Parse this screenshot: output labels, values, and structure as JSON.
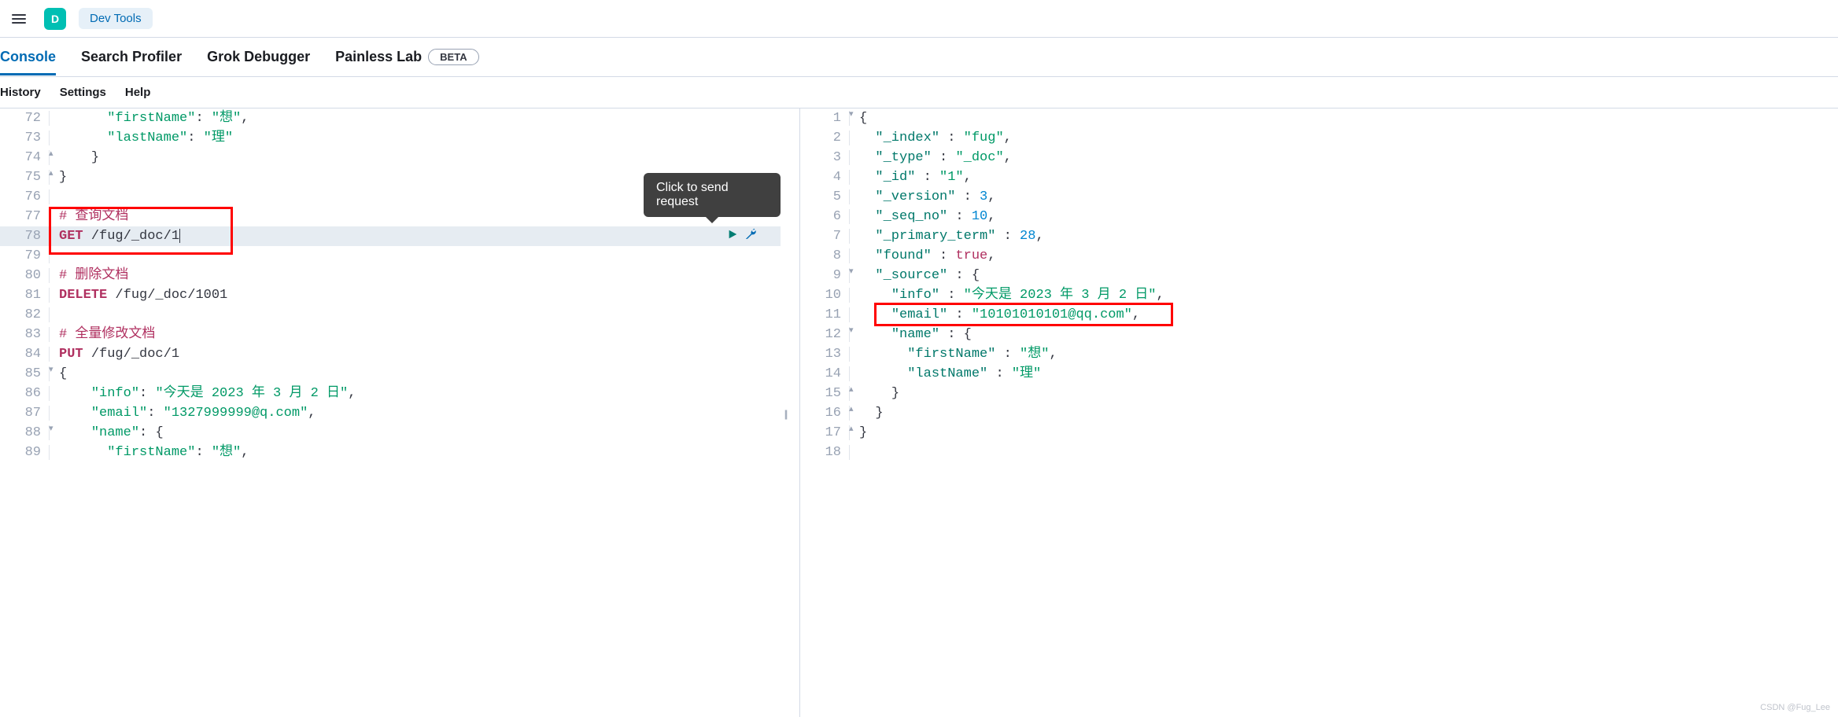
{
  "header": {
    "appInitial": "D",
    "appName": "Dev Tools"
  },
  "tabs": {
    "items": [
      "Console",
      "Search Profiler",
      "Grok Debugger",
      "Painless Lab"
    ],
    "activeIndex": 0,
    "betaBadge": "BETA"
  },
  "subnav": {
    "items": [
      "History",
      "Settings",
      "Help"
    ]
  },
  "tooltip": "Click to send request",
  "leftEditor": {
    "startLine": 72,
    "lines": [
      {
        "n": 72,
        "indent": "      ",
        "tokens": [
          {
            "t": "\"firstName\"",
            "c": "k-key"
          },
          {
            "t": ": ",
            "c": "k-punc"
          },
          {
            "t": "\"想\"",
            "c": "k-str"
          },
          {
            "t": ",",
            "c": "k-punc"
          }
        ]
      },
      {
        "n": 73,
        "indent": "      ",
        "tokens": [
          {
            "t": "\"lastName\"",
            "c": "k-key"
          },
          {
            "t": ": ",
            "c": "k-punc"
          },
          {
            "t": "\"理\"",
            "c": "k-str"
          }
        ]
      },
      {
        "n": 74,
        "indent": "    ",
        "fold": "up",
        "tokens": [
          {
            "t": "}",
            "c": "k-punc"
          }
        ]
      },
      {
        "n": 75,
        "indent": "",
        "fold": "up",
        "tokens": [
          {
            "t": "}",
            "c": "k-punc"
          }
        ]
      },
      {
        "n": 76,
        "indent": "",
        "tokens": []
      },
      {
        "n": 77,
        "indent": "",
        "tokens": [
          {
            "t": "# 查询文档",
            "c": "k-comment"
          }
        ]
      },
      {
        "n": 78,
        "indent": "",
        "hl": true,
        "actions": true,
        "tokens": [
          {
            "t": "GET",
            "c": "k-method"
          },
          {
            "t": " ",
            "c": ""
          },
          {
            "t": "/fug/_doc/1",
            "c": "k-path"
          }
        ],
        "cursor": true
      },
      {
        "n": 79,
        "indent": "",
        "tokens": []
      },
      {
        "n": 80,
        "indent": "",
        "tokens": [
          {
            "t": "# 删除文档",
            "c": "k-comment"
          }
        ]
      },
      {
        "n": 81,
        "indent": "",
        "tokens": [
          {
            "t": "DELETE",
            "c": "k-method"
          },
          {
            "t": " ",
            "c": ""
          },
          {
            "t": "/fug/_doc/1001",
            "c": "k-path"
          }
        ]
      },
      {
        "n": 82,
        "indent": "",
        "tokens": []
      },
      {
        "n": 83,
        "indent": "",
        "tokens": [
          {
            "t": "# 全量修改文档",
            "c": "k-comment"
          }
        ]
      },
      {
        "n": 84,
        "indent": "",
        "tokens": [
          {
            "t": "PUT",
            "c": "k-method"
          },
          {
            "t": " ",
            "c": ""
          },
          {
            "t": "/fug/_doc/1",
            "c": "k-path"
          }
        ]
      },
      {
        "n": 85,
        "indent": "",
        "fold": "down",
        "tokens": [
          {
            "t": "{",
            "c": "k-punc"
          }
        ]
      },
      {
        "n": 86,
        "indent": "    ",
        "tokens": [
          {
            "t": "\"info\"",
            "c": "k-key"
          },
          {
            "t": ": ",
            "c": "k-punc"
          },
          {
            "t": "\"今天是 2023 年 3 月 2 日\"",
            "c": "k-str"
          },
          {
            "t": ",",
            "c": "k-punc"
          }
        ]
      },
      {
        "n": 87,
        "indent": "    ",
        "tokens": [
          {
            "t": "\"email\"",
            "c": "k-key"
          },
          {
            "t": ": ",
            "c": "k-punc"
          },
          {
            "t": "\"1327999999@q.com\"",
            "c": "k-str"
          },
          {
            "t": ",",
            "c": "k-punc"
          }
        ]
      },
      {
        "n": 88,
        "indent": "    ",
        "fold": "down",
        "tokens": [
          {
            "t": "\"name\"",
            "c": "k-key"
          },
          {
            "t": ": ",
            "c": "k-punc"
          },
          {
            "t": "{",
            "c": "k-punc"
          }
        ]
      },
      {
        "n": 89,
        "indent": "      ",
        "tokens": [
          {
            "t": "\"firstName\"",
            "c": "k-key"
          },
          {
            "t": ": ",
            "c": "k-punc"
          },
          {
            "t": "\"想\"",
            "c": "k-str"
          },
          {
            "t": ",",
            "c": "k-punc"
          }
        ]
      }
    ]
  },
  "rightEditor": {
    "lines": [
      {
        "n": 1,
        "indent": "",
        "fold": "down",
        "tokens": [
          {
            "t": "{",
            "c": "k-punc"
          }
        ]
      },
      {
        "n": 2,
        "indent": "  ",
        "tokens": [
          {
            "t": "\"_index\"",
            "c": "k-label"
          },
          {
            "t": " : ",
            "c": "k-punc"
          },
          {
            "t": "\"fug\"",
            "c": "k-str"
          },
          {
            "t": ",",
            "c": "k-punc"
          }
        ]
      },
      {
        "n": 3,
        "indent": "  ",
        "tokens": [
          {
            "t": "\"_type\"",
            "c": "k-label"
          },
          {
            "t": " : ",
            "c": "k-punc"
          },
          {
            "t": "\"_doc\"",
            "c": "k-str"
          },
          {
            "t": ",",
            "c": "k-punc"
          }
        ]
      },
      {
        "n": 4,
        "indent": "  ",
        "tokens": [
          {
            "t": "\"_id\"",
            "c": "k-label"
          },
          {
            "t": " : ",
            "c": "k-punc"
          },
          {
            "t": "\"1\"",
            "c": "k-str"
          },
          {
            "t": ",",
            "c": "k-punc"
          }
        ]
      },
      {
        "n": 5,
        "indent": "  ",
        "tokens": [
          {
            "t": "\"_version\"",
            "c": "k-label"
          },
          {
            "t": " : ",
            "c": "k-punc"
          },
          {
            "t": "3",
            "c": "k-num"
          },
          {
            "t": ",",
            "c": "k-punc"
          }
        ]
      },
      {
        "n": 6,
        "indent": "  ",
        "tokens": [
          {
            "t": "\"_seq_no\"",
            "c": "k-label"
          },
          {
            "t": " : ",
            "c": "k-punc"
          },
          {
            "t": "10",
            "c": "k-num"
          },
          {
            "t": ",",
            "c": "k-punc"
          }
        ]
      },
      {
        "n": 7,
        "indent": "  ",
        "tokens": [
          {
            "t": "\"_primary_term\"",
            "c": "k-label"
          },
          {
            "t": " : ",
            "c": "k-punc"
          },
          {
            "t": "28",
            "c": "k-num"
          },
          {
            "t": ",",
            "c": "k-punc"
          }
        ]
      },
      {
        "n": 8,
        "indent": "  ",
        "tokens": [
          {
            "t": "\"found\"",
            "c": "k-label"
          },
          {
            "t": " : ",
            "c": "k-punc"
          },
          {
            "t": "true",
            "c": "k-bool"
          },
          {
            "t": ",",
            "c": "k-punc"
          }
        ]
      },
      {
        "n": 9,
        "indent": "  ",
        "fold": "down",
        "tokens": [
          {
            "t": "\"_source\"",
            "c": "k-label"
          },
          {
            "t": " : ",
            "c": "k-punc"
          },
          {
            "t": "{",
            "c": "k-punc"
          }
        ]
      },
      {
        "n": 10,
        "indent": "    ",
        "tokens": [
          {
            "t": "\"info\"",
            "c": "k-label"
          },
          {
            "t": " : ",
            "c": "k-punc"
          },
          {
            "t": "\"今天是 2023 年 3 月 2 日\"",
            "c": "k-str"
          },
          {
            "t": ",",
            "c": "k-punc"
          }
        ]
      },
      {
        "n": 11,
        "indent": "    ",
        "redbox": true,
        "tokens": [
          {
            "t": "\"email\"",
            "c": "k-label"
          },
          {
            "t": " : ",
            "c": "k-punc"
          },
          {
            "t": "\"10101010101@qq.com\"",
            "c": "k-str"
          },
          {
            "t": ",",
            "c": "k-punc"
          }
        ]
      },
      {
        "n": 12,
        "indent": "    ",
        "fold": "down",
        "tokens": [
          {
            "t": "\"name\"",
            "c": "k-label"
          },
          {
            "t": " : ",
            "c": "k-punc"
          },
          {
            "t": "{",
            "c": "k-punc"
          }
        ]
      },
      {
        "n": 13,
        "indent": "      ",
        "tokens": [
          {
            "t": "\"firstName\"",
            "c": "k-label"
          },
          {
            "t": " : ",
            "c": "k-punc"
          },
          {
            "t": "\"想\"",
            "c": "k-str"
          },
          {
            "t": ",",
            "c": "k-punc"
          }
        ]
      },
      {
        "n": 14,
        "indent": "      ",
        "tokens": [
          {
            "t": "\"lastName\"",
            "c": "k-label"
          },
          {
            "t": " : ",
            "c": "k-punc"
          },
          {
            "t": "\"理\"",
            "c": "k-str"
          }
        ]
      },
      {
        "n": 15,
        "indent": "    ",
        "fold": "up",
        "tokens": [
          {
            "t": "}",
            "c": "k-punc"
          }
        ]
      },
      {
        "n": 16,
        "indent": "  ",
        "fold": "up",
        "tokens": [
          {
            "t": "}",
            "c": "k-punc"
          }
        ]
      },
      {
        "n": 17,
        "indent": "",
        "fold": "up",
        "tokens": [
          {
            "t": "}",
            "c": "k-punc"
          }
        ]
      },
      {
        "n": 18,
        "indent": "",
        "tokens": []
      }
    ]
  },
  "watermark": "CSDN @Fug_Lee"
}
